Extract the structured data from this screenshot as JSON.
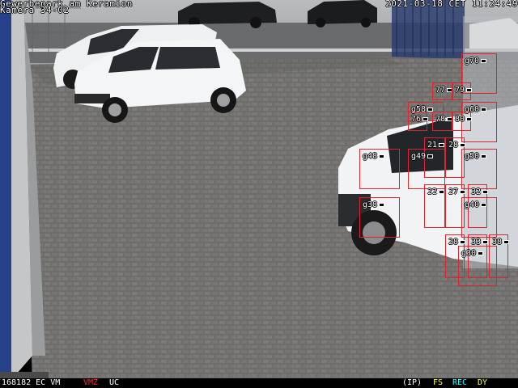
{
  "osd": {
    "title": "Gewerbepark am Keramion",
    "camera": "Kamera 34-02",
    "datetime": "2021-03-18 CET 11:24:49"
  },
  "status_bar": {
    "left": "168182 EC VM",
    "vmz": "VMZ",
    "uc": "UC",
    "ip": "(IP)",
    "fs": "FS",
    "rec": "REC",
    "dy": "DY",
    "colors": {
      "white": "#ffffff",
      "red": "#ff2a2a",
      "yellow": "#ffff33",
      "cyan": "#33ffff"
    }
  },
  "detections": [
    {
      "label": "g70"
    },
    {
      "label": "77"
    },
    {
      "label": "79"
    },
    {
      "label": "g58"
    },
    {
      "label": "g60"
    },
    {
      "label": "76"
    },
    {
      "label": "78"
    },
    {
      "label": "80"
    },
    {
      "label": "21"
    },
    {
      "label": "28"
    },
    {
      "label": "g48"
    },
    {
      "label": "g49"
    },
    {
      "label": "g50"
    },
    {
      "label": "22"
    },
    {
      "label": "27"
    },
    {
      "label": "32"
    },
    {
      "label": "g38"
    },
    {
      "label": "g40"
    },
    {
      "label": "28"
    },
    {
      "label": "33"
    },
    {
      "label": "38"
    },
    {
      "label": "g30"
    }
  ],
  "box_color": "#e0242c"
}
